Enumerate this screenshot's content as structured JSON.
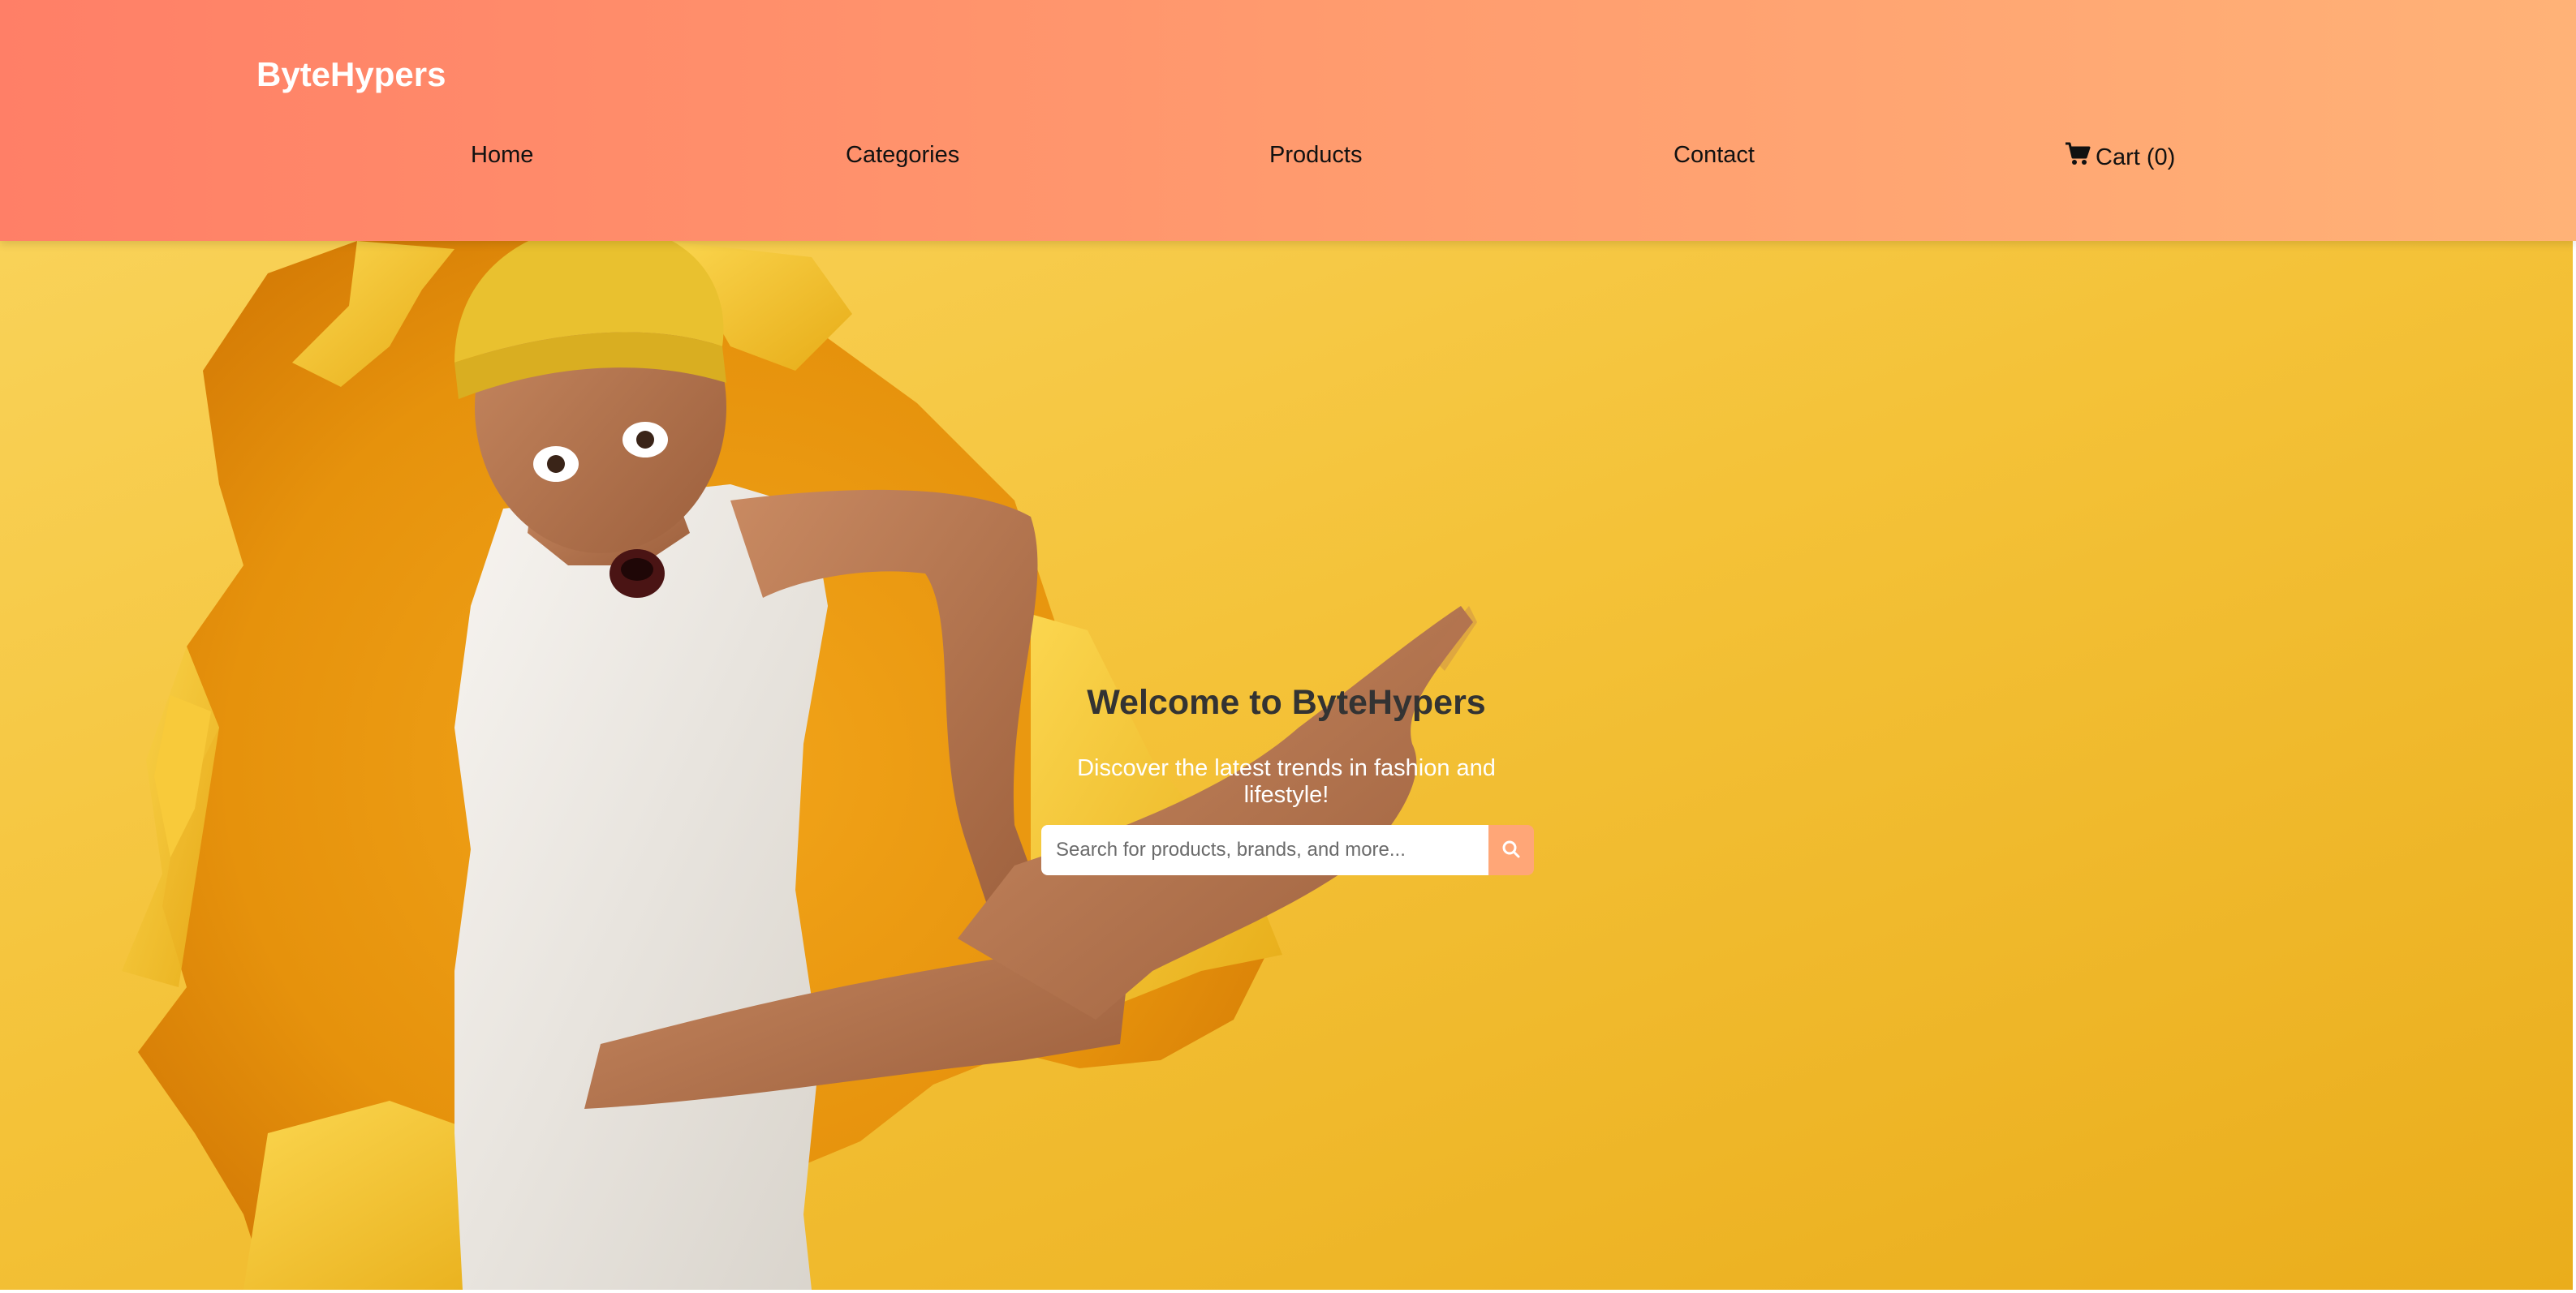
{
  "brand": {
    "name": "ByteHypers"
  },
  "nav": {
    "items": [
      {
        "label": "Home"
      },
      {
        "label": "Categories"
      },
      {
        "label": "Products"
      },
      {
        "label": "Contact"
      }
    ],
    "cart": {
      "label": "Cart (0)",
      "icon": "cart-icon"
    }
  },
  "hero": {
    "title": "Welcome to ByteHypers",
    "subtitle": "Discover the latest trends in fashion and lifestyle!",
    "search": {
      "placeholder": "Search for products, brands, and more...",
      "icon": "search-icon"
    },
    "image": "man-bursting-through-yellow-paper-pointing"
  },
  "colors": {
    "header_gradient_start": "#ff7f67",
    "header_gradient_end": "#ffb277",
    "hero_background": "#f4c238",
    "search_button": "#ffa677",
    "title_text": "#333333"
  }
}
